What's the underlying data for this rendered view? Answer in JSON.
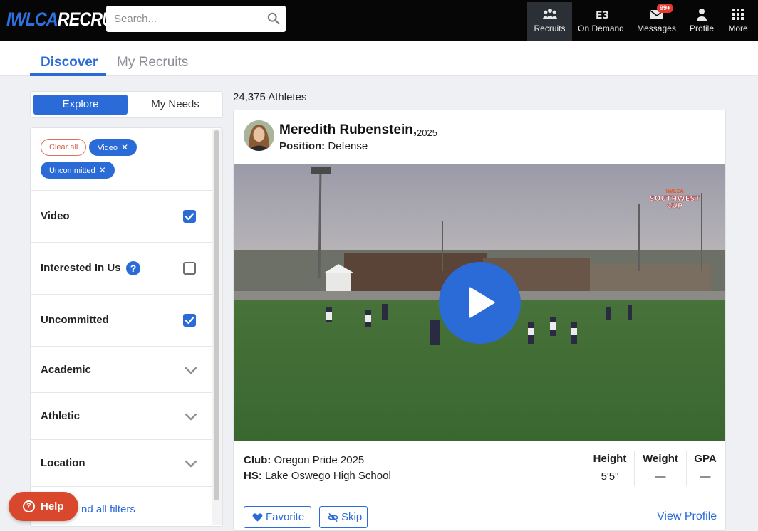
{
  "app": {
    "logo_part1": "IWLCA",
    "logo_part2": "RECRUITS"
  },
  "search": {
    "placeholder": "Search..."
  },
  "nav": {
    "items": [
      {
        "label": "Recruits",
        "icon": "team-icon",
        "active": true
      },
      {
        "label": "On Demand",
        "icon": "on-demand-icon"
      },
      {
        "label": "Messages",
        "icon": "mail-icon",
        "badge": "99+"
      },
      {
        "label": "Profile",
        "icon": "person-icon"
      },
      {
        "label": "More",
        "icon": "grid-icon"
      }
    ]
  },
  "tabs": [
    {
      "label": "Discover",
      "active": true
    },
    {
      "label": "My Recruits"
    }
  ],
  "segment": {
    "explore": "Explore",
    "my_needs": "My Needs"
  },
  "filters": {
    "chips": [
      {
        "label": "Clear all"
      },
      {
        "label": "Video",
        "remove": "✕"
      },
      {
        "label": "Uncommitted",
        "remove": "✕"
      }
    ],
    "rows": [
      {
        "label": "Video",
        "checked": true
      },
      {
        "label": "Interested In Us",
        "checked": false,
        "help": "?"
      },
      {
        "label": "Uncommitted",
        "checked": true
      },
      {
        "label": "Academic"
      },
      {
        "label": "Athletic"
      },
      {
        "label": "Location"
      }
    ],
    "expand_link": "nd all filters"
  },
  "help_button": {
    "label": "Help",
    "icon_text": "?"
  },
  "results": {
    "count": "24,375 Athletes"
  },
  "athlete": {
    "name": "Meredith Rubenstein,",
    "year": "2025",
    "position_label": "Position:",
    "position": "Defense",
    "club_label": "Club:",
    "club": "Oregon Pride 2025",
    "hs_label": "HS:",
    "hs": "Lake Oswego High School",
    "stats": [
      {
        "label": "Height",
        "value": "5'5\""
      },
      {
        "label": "Weight",
        "value": "—"
      },
      {
        "label": "GPA",
        "value": "—"
      }
    ],
    "video_watermark": [
      "IWLCA",
      "SOUTHWEST",
      "CUP"
    ]
  },
  "actions": {
    "favorite": "Favorite",
    "skip": "Skip",
    "view_profile": "View Profile"
  },
  "colors": {
    "accent": "#2a6bd8",
    "topbar": "#060606",
    "help": "#d9482d",
    "badge": "#e53a2f"
  }
}
